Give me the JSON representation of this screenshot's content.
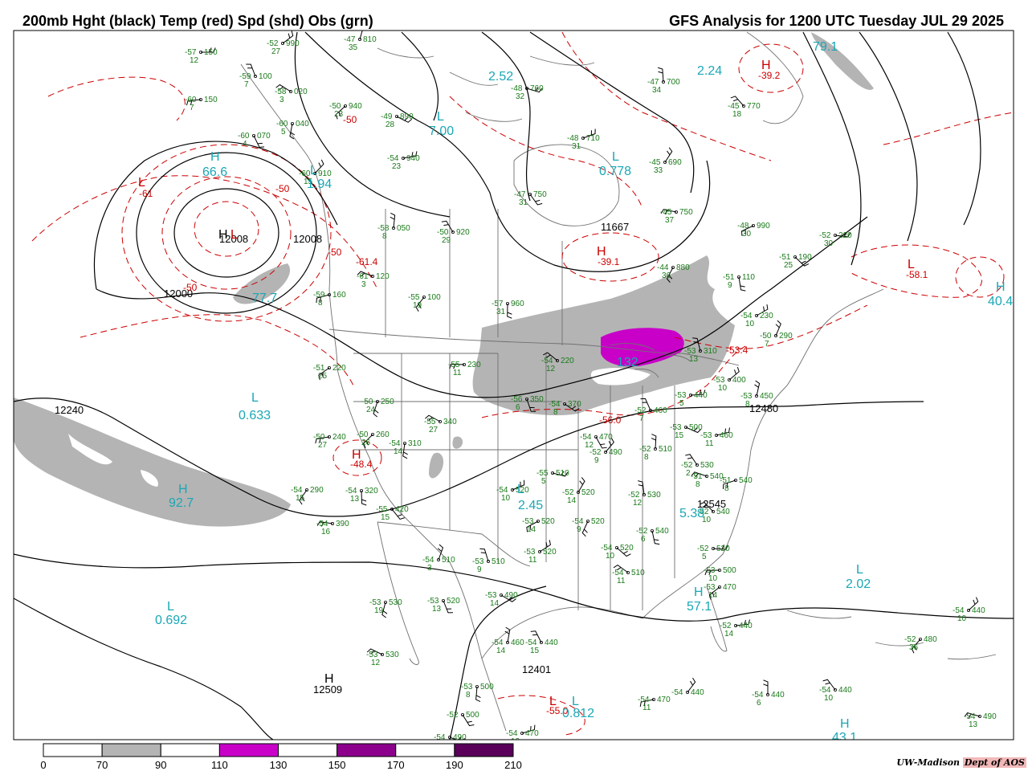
{
  "header": {
    "left_title": "200mb Hght (black) Temp (red) Spd (shd) Obs (grn)",
    "right_title": "GFS Analysis for 1200 UTC Tuesday  JUL 29 2025"
  },
  "colors": {
    "height": "#000000",
    "temp": "#cc0000",
    "speed_label": "#1aa7b5",
    "obs": "#1a7a1a",
    "shade_70": "#b4b4b4",
    "shade_110": "#c800c8",
    "shade_150": "#8c008c",
    "shade_190": "#5a005a",
    "border": "#707070"
  },
  "height_labels": [
    "12240",
    "12480",
    "12000",
    "11667",
    "12545",
    "12401",
    "12509",
    "12008",
    "12008"
  ],
  "temp_labels": [
    "-61",
    "-50",
    "-50",
    "-61.4",
    "-50",
    "-50",
    "-58.1",
    "-53.4",
    "-56.0",
    "-48.4",
    "-39.1",
    "-39.2",
    "-55.0"
  ],
  "extrema": [
    "H",
    "L",
    "H",
    "L",
    "L",
    "L",
    "L",
    "H",
    "L",
    "H",
    "H",
    "L",
    "L",
    "H",
    "L",
    "H",
    "H",
    "L",
    "L",
    "L",
    "H"
  ],
  "speed_values": [
    "66.6",
    "1.94",
    "77.7",
    "0.633",
    "92.7",
    "0.692",
    "7.00",
    "2.52",
    "0.778",
    "132",
    "2.45",
    "5.38",
    "57.1",
    "2.02",
    "79.1",
    "2.24",
    "40.4",
    "0.812",
    "43.1",
    "H"
  ],
  "obs": [
    {
      "t": "-57",
      "h": "150",
      "w": "12"
    },
    {
      "t": "-52",
      "h": "990",
      "w": "27"
    },
    {
      "t": "-47",
      "h": "810",
      "w": "35"
    },
    {
      "t": "-59",
      "h": "100",
      "w": "7"
    },
    {
      "t": "-58",
      "h": "020",
      "w": "3"
    },
    {
      "t": "-60",
      "h": "150",
      "w": "7"
    },
    {
      "t": "-50",
      "h": "940",
      "w": "23"
    },
    {
      "t": "-60",
      "h": "040",
      "w": "5"
    },
    {
      "t": "-60",
      "h": "070",
      "w": "4"
    },
    {
      "t": "-49",
      "h": "890",
      "w": "28"
    },
    {
      "t": "-54",
      "h": "940",
      "w": "23"
    },
    {
      "t": "-60",
      "h": "910",
      "w": "15"
    },
    {
      "t": "-58",
      "h": "050",
      "w": "8"
    },
    {
      "t": "-50",
      "h": "920",
      "w": "29"
    },
    {
      "t": "-61",
      "h": "120",
      "w": "3"
    },
    {
      "t": "-59",
      "h": "160",
      "w": "8"
    },
    {
      "t": "-55",
      "h": "100",
      "w": "19"
    },
    {
      "t": "-57",
      "h": "960",
      "w": "31"
    },
    {
      "t": "-47",
      "h": "750",
      "w": "31"
    },
    {
      "t": "-48",
      "h": "760",
      "w": "32"
    },
    {
      "t": "-48",
      "h": "710",
      "w": "31"
    },
    {
      "t": "-45",
      "h": "690",
      "w": "33"
    },
    {
      "t": "-47",
      "h": "700",
      "w": "34"
    },
    {
      "t": "-45",
      "h": "770",
      "w": "18"
    },
    {
      "t": "-45",
      "h": "750",
      "w": "37"
    },
    {
      "t": "-48",
      "h": "990",
      "w": "30"
    },
    {
      "t": "-44",
      "h": "880",
      "w": "36"
    },
    {
      "t": "-51",
      "h": "110",
      "w": "9"
    },
    {
      "t": "-51",
      "h": "190",
      "w": "25"
    },
    {
      "t": "-52",
      "h": "220",
      "w": "30"
    },
    {
      "t": "-54",
      "h": "230",
      "w": "10"
    },
    {
      "t": "-50",
      "h": "290",
      "w": "7"
    },
    {
      "t": "-53",
      "h": "310",
      "w": "13"
    },
    {
      "t": "-54",
      "h": "220",
      "w": "12"
    },
    {
      "t": "-55",
      "h": "230",
      "w": "11"
    },
    {
      "t": "-51",
      "h": "220",
      "w": "25"
    },
    {
      "t": "-50",
      "h": "250",
      "w": "24"
    },
    {
      "t": "-56",
      "h": "350",
      "w": "6"
    },
    {
      "t": "-54",
      "h": "370",
      "w": "8"
    },
    {
      "t": "-53",
      "h": "440",
      "w": "5"
    },
    {
      "t": "-53",
      "h": "400",
      "w": "10"
    },
    {
      "t": "-53",
      "h": "450",
      "w": "8"
    },
    {
      "t": "-52",
      "h": "460",
      "w": "7"
    },
    {
      "t": "-55",
      "h": "340",
      "w": "27"
    },
    {
      "t": "-50",
      "h": "240",
      "w": "27"
    },
    {
      "t": "-50",
      "h": "260",
      "w": "26"
    },
    {
      "t": "-54",
      "h": "310",
      "w": "14"
    },
    {
      "t": "-54",
      "h": "470",
      "w": "12"
    },
    {
      "t": "-53",
      "h": "500",
      "w": "15"
    },
    {
      "t": "-53",
      "h": "460",
      "w": "11"
    },
    {
      "t": "-52",
      "h": "490",
      "w": "9"
    },
    {
      "t": "-52",
      "h": "510",
      "w": "8"
    },
    {
      "t": "-52",
      "h": "530",
      "w": "2"
    },
    {
      "t": "-51",
      "h": "540",
      "w": "8"
    },
    {
      "t": "-51",
      "h": "540",
      "w": "8"
    },
    {
      "t": "-54",
      "h": "290",
      "w": "15"
    },
    {
      "t": "-54",
      "h": "320",
      "w": "13"
    },
    {
      "t": "-55",
      "h": "420",
      "w": "15"
    },
    {
      "t": "-55",
      "h": "510",
      "w": "5"
    },
    {
      "t": "-54",
      "h": "520",
      "w": "10"
    },
    {
      "t": "-52",
      "h": "520",
      "w": "14"
    },
    {
      "t": "-52",
      "h": "530",
      "w": "12"
    },
    {
      "t": "-52",
      "h": "540",
      "w": "10"
    },
    {
      "t": "-54",
      "h": "390",
      "w": "16"
    },
    {
      "t": "-53",
      "h": "520",
      "w": "14"
    },
    {
      "t": "-54",
      "h": "520",
      "w": "9"
    },
    {
      "t": "-52",
      "h": "540",
      "w": "6"
    },
    {
      "t": "-54",
      "h": "520",
      "w": "10"
    },
    {
      "t": "-52",
      "h": "520",
      "w": "5"
    },
    {
      "t": "-53",
      "h": "520",
      "w": "11"
    },
    {
      "t": "-54",
      "h": "510",
      "w": "3"
    },
    {
      "t": "-53",
      "h": "510",
      "w": "9"
    },
    {
      "t": "-54",
      "h": "510",
      "w": "11"
    },
    {
      "t": "-53",
      "h": "500",
      "w": "10"
    },
    {
      "t": "-53",
      "h": "470",
      "w": "14"
    },
    {
      "t": "-53",
      "h": "530",
      "w": "19"
    },
    {
      "t": "-53",
      "h": "520",
      "w": "13"
    },
    {
      "t": "-53",
      "h": "490",
      "w": "14"
    },
    {
      "t": "-52",
      "h": "440",
      "w": "14"
    },
    {
      "t": "-54",
      "h": "440",
      "w": "10"
    },
    {
      "t": "-54",
      "h": "460",
      "w": "14"
    },
    {
      "t": "-54",
      "h": "440",
      "w": "15"
    },
    {
      "t": "-53",
      "h": "530",
      "w": "12"
    },
    {
      "t": "-54",
      "h": "470",
      "w": "11"
    },
    {
      "t": "-52",
      "h": "480",
      "w": "36"
    },
    {
      "t": "-53",
      "h": "500",
      "w": "8"
    },
    {
      "t": "-52",
      "h": "500",
      "w": ""
    },
    {
      "t": "-54",
      "h": "490",
      "w": ""
    },
    {
      "t": "-54",
      "h": "470",
      "w": "12"
    },
    {
      "t": "-54",
      "h": "440",
      "w": ""
    },
    {
      "t": "-54",
      "h": "440",
      "w": "6"
    },
    {
      "t": "-54",
      "h": "440",
      "w": "10"
    },
    {
      "t": "-54",
      "h": "490",
      "w": "13"
    }
  ],
  "legend": {
    "ticks": [
      "0",
      "70",
      "90",
      "110",
      "130",
      "150",
      "170",
      "190",
      "210"
    ],
    "shades": [
      "#ffffff",
      "#b4b4b4",
      "#ffffff",
      "#c800c8",
      "#ffffff",
      "#8c008c",
      "#ffffff",
      "#5a005a"
    ]
  },
  "credit": {
    "org": "UW-Madison",
    "dept": "Dept of AOS"
  }
}
